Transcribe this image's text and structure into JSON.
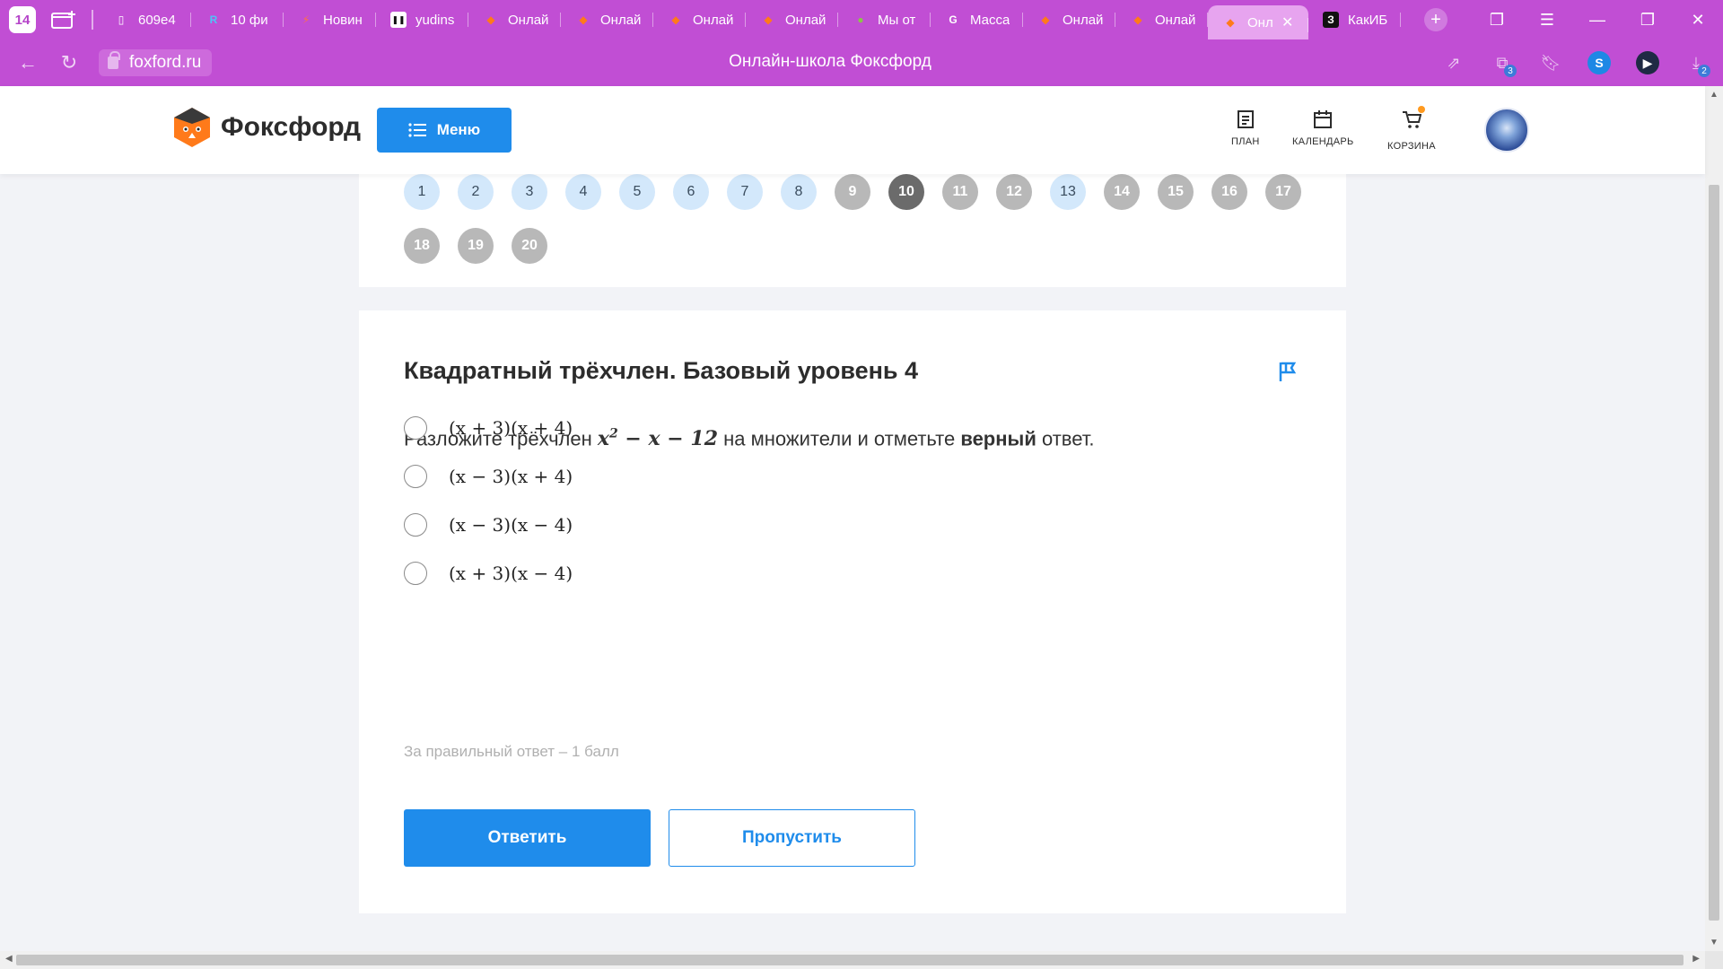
{
  "browser": {
    "tab_count": "14",
    "tabs": [
      {
        "title": "609e4",
        "icon": "document-icon",
        "color": "#ffffff"
      },
      {
        "title": "10 фи",
        "icon": "r-logo-icon",
        "color": "#4fc3f7"
      },
      {
        "title": "Новин",
        "icon": "lightning-icon",
        "color": "#ff7043"
      },
      {
        "title": "yudins",
        "icon": "pause-logo-icon",
        "color": "#ffffff"
      },
      {
        "title": "Онлай",
        "icon": "fox-icon",
        "color": "#ff7a1a"
      },
      {
        "title": "Онлай",
        "icon": "fox-icon",
        "color": "#ff7a1a"
      },
      {
        "title": "Онлай",
        "icon": "fox-icon",
        "color": "#ff7a1a"
      },
      {
        "title": "Онлай",
        "icon": "fox-icon",
        "color": "#ff7a1a"
      },
      {
        "title": "Мы от",
        "icon": "globe-icon",
        "color": "#8bc34a"
      },
      {
        "title": "Масса",
        "icon": "google-icon",
        "color": "#ffffff"
      },
      {
        "title": "Онлай",
        "icon": "fox-icon",
        "color": "#ff7a1a"
      },
      {
        "title": "Онлай",
        "icon": "fox-icon",
        "color": "#ff7a1a"
      },
      {
        "title": "Онл",
        "icon": "fox-icon",
        "color": "#ff7a1a",
        "active": true
      },
      {
        "title": "КакИБ",
        "icon": "z-logo-icon",
        "color": "#111111"
      }
    ],
    "url": "foxford.ru",
    "page_title": "Онлайн-школа Фоксфорд",
    "downloads_badge": "2",
    "extension_badge": "3"
  },
  "header": {
    "brand": "Фоксфорд",
    "menu_label": "Меню",
    "nav": [
      {
        "label": "ПЛАН",
        "icon": "plan-icon"
      },
      {
        "label": "КАЛЕНДАРЬ",
        "icon": "calendar-icon"
      },
      {
        "label": "КОРЗИНА",
        "icon": "cart-icon"
      }
    ]
  },
  "question_nav": {
    "numbers": [
      "1",
      "2",
      "3",
      "4",
      "5",
      "6",
      "7",
      "8",
      "9",
      "10",
      "11",
      "12",
      "13",
      "14",
      "15",
      "16",
      "17",
      "18",
      "19",
      "20"
    ],
    "states": [
      "blue",
      "blue",
      "blue",
      "blue",
      "blue",
      "blue",
      "blue",
      "blue",
      "grey",
      "current",
      "grey",
      "grey",
      "blue",
      "grey",
      "grey",
      "grey",
      "grey",
      "grey",
      "grey",
      "grey"
    ]
  },
  "task": {
    "title": "Квадратный трёхчлен. Базовый уровень 4",
    "question_prefix": "Разложите трёхчлен ",
    "expr_x": "x",
    "expr_exp": "2",
    "expr_rest": " − x − 12",
    "question_middle": " на множители и отметьте ",
    "question_bold": "верный",
    "question_suffix": " ответ.",
    "options": [
      "(x + 3)(x + 4)",
      "(x − 3)(x + 4)",
      "(x − 3)(x − 4)",
      "(x + 3)(x − 4)"
    ],
    "score_note": "За правильный ответ – 1 балл",
    "answer_label": "Ответить",
    "skip_label": "Пропустить"
  },
  "colors": {
    "browser_chrome": "#c14ed4",
    "accent": "#1f8ceb",
    "nav_done": "#d3e8fb",
    "nav_pending": "#b8b8b8",
    "nav_current": "#6b6b6b"
  }
}
